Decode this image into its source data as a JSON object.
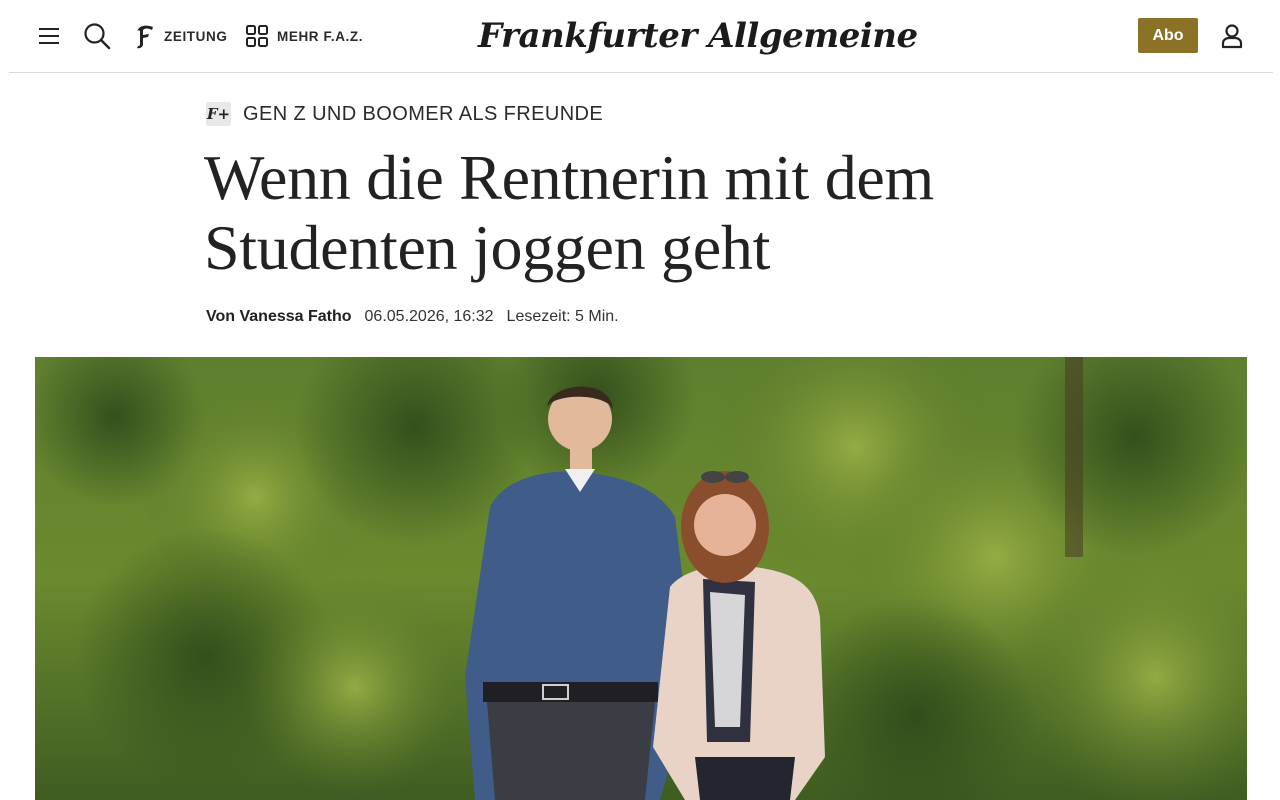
{
  "header": {
    "menu_icon": "hamburger-icon",
    "search_icon": "search-icon",
    "zeitung_label": "ZEITUNG",
    "mehr_label": "MEHR F.A.Z.",
    "logo_text": "Frankfurter Allgemeine",
    "abo_label": "Abo",
    "user_icon": "user-icon"
  },
  "article": {
    "badge": "F+",
    "kicker": "GEN Z UND BOOMER ALS FREUNDE",
    "headline_line1": "Wenn die Rentnerin mit dem",
    "headline_line2": "Studenten joggen geht",
    "author": "Von Vanessa Fatho",
    "date": "06.05.2026, 16:32",
    "reading_time": "Lesezeit: 5 Min."
  },
  "colors": {
    "accent": "#8c7226",
    "text": "#222222",
    "divider": "#d9d9d9"
  }
}
